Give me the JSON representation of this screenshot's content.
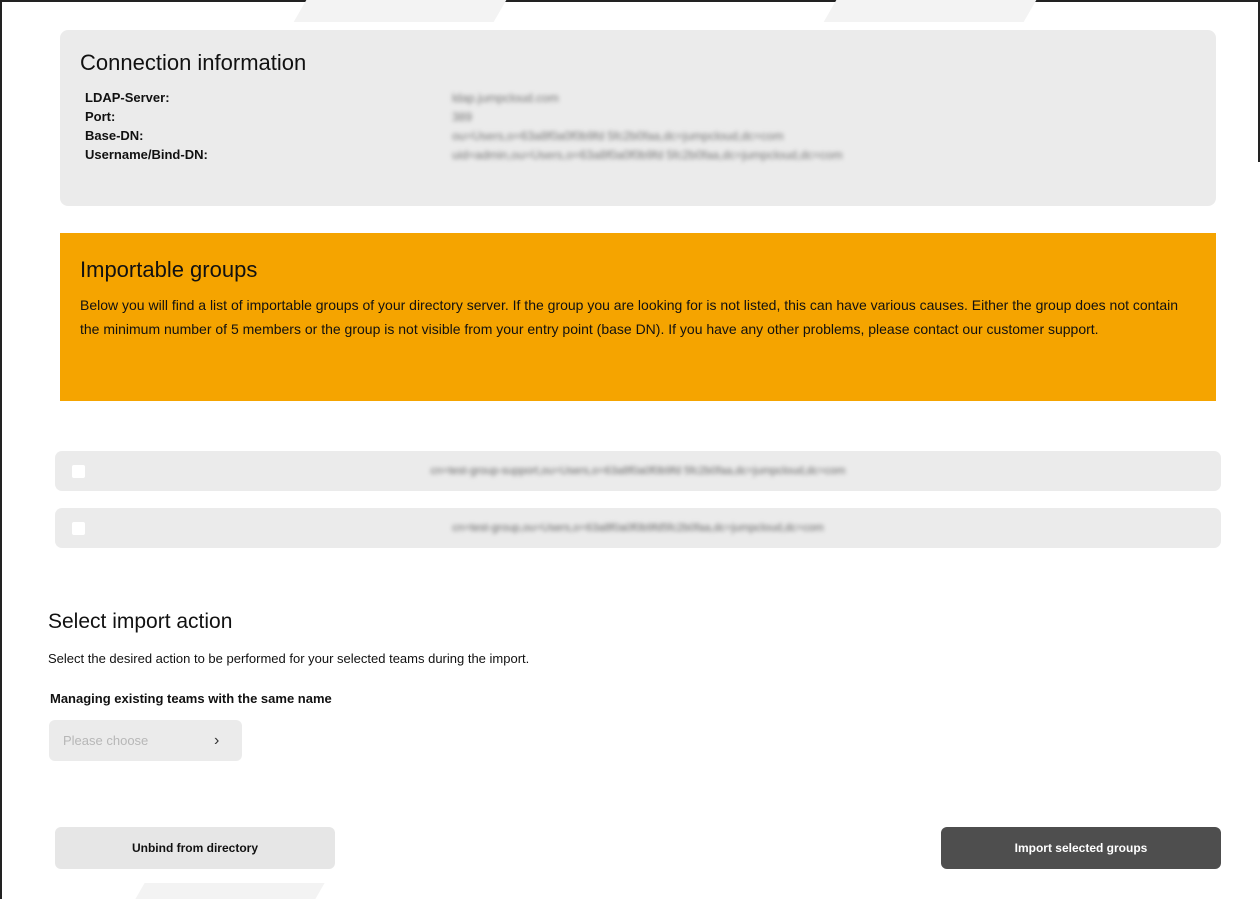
{
  "connection": {
    "title": "Connection information",
    "rows": [
      {
        "label": "LDAP-Server:",
        "value": "ldap.jumpcloud.com"
      },
      {
        "label": "Port:",
        "value": "389"
      },
      {
        "label": "Base-DN:",
        "value": "ou=Users,o=63a8f0a0f0b9fd 5fc2b0faa,dc=jumpcloud,dc=com"
      },
      {
        "label": "Username/Bind-DN:",
        "value": "uid=admin,ou=Users,o=63a8f0a0f0b9fd 5fc2b0faa,dc=jumpcloud,dc=com"
      }
    ]
  },
  "notice": {
    "title": "Importable groups",
    "text": "Below you will find a list of importable groups of your directory server. If the group you are looking for is not listed, this can have various causes. Either the group does not contain the minimum number of 5 members or the group is not visible from your entry point (base DN). If you have any other problems, please contact our customer support.",
    "color": "#f5a400"
  },
  "groups": [
    {
      "name": "cn=test-group-support,ou=Users,o=63a8f0a0f0b9fd 5fc2b0faa,dc=jumpcloud,dc=com",
      "checked": false
    },
    {
      "name": "cn=test-group,ou=Users,o=63a8f0a0f0b9fd5fc2b0faa,dc=jumpcloud,dc=com",
      "checked": false
    }
  ],
  "import_action": {
    "title": "Select import action",
    "description": "Select the desired action to be performed for your selected teams during the import.",
    "manage_label": "Managing existing teams with the same name",
    "select_placeholder": "Please choose",
    "chevron_icon": "chevron-right-icon"
  },
  "buttons": {
    "unbind": "Unbind from directory",
    "import": "Import selected groups"
  }
}
